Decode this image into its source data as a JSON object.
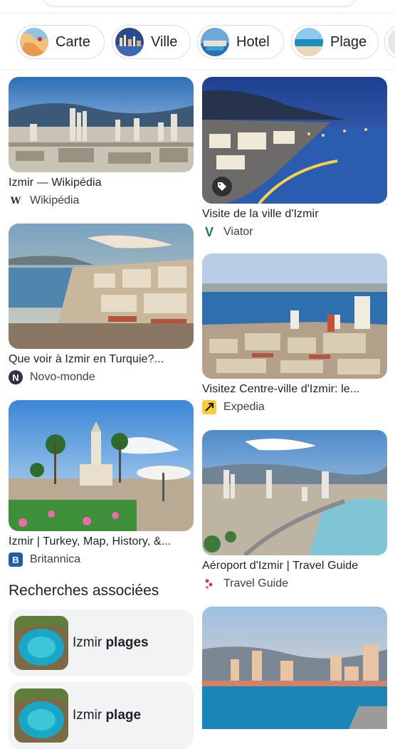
{
  "chips": [
    {
      "label": "Carte",
      "icon": "map-thumbnail"
    },
    {
      "label": "Ville",
      "icon": "city-thumbnail"
    },
    {
      "label": "Hotel",
      "icon": "hotel-thumbnail"
    },
    {
      "label": "Plage",
      "icon": "beach-thumbnail"
    }
  ],
  "results_left": [
    {
      "title": "Izmir — Wikipédia",
      "source": "Wikipédia",
      "favicon": "W"
    },
    {
      "title": "Que voir à Izmir en Turquie?...",
      "source": "Novo-monde",
      "favicon": "N"
    },
    {
      "title": "İzmir | Turkey, Map, History, &...",
      "source": "Britannica",
      "favicon": "B"
    }
  ],
  "results_right": [
    {
      "title": "Visite de la ville d'Izmir",
      "source": "Viator",
      "favicon": "V"
    },
    {
      "title": "Visitez Centre-ville d'Izmir: le...",
      "source": "Expedia",
      "favicon": "E"
    },
    {
      "title": "Aéroport d'Izmir | Travel Guide",
      "source": "Travel Guide",
      "favicon": "T"
    }
  ],
  "related": {
    "heading": "Recherches associées",
    "items": [
      {
        "prefix": "Izmir ",
        "bold": "plages"
      },
      {
        "prefix": "Izmir ",
        "bold": "plage"
      }
    ]
  },
  "colors": {
    "viator": "#1a7a5c",
    "expedia": "#fbcc33",
    "britannica": "#1f5fa6",
    "travelguide": "#e0246f"
  }
}
